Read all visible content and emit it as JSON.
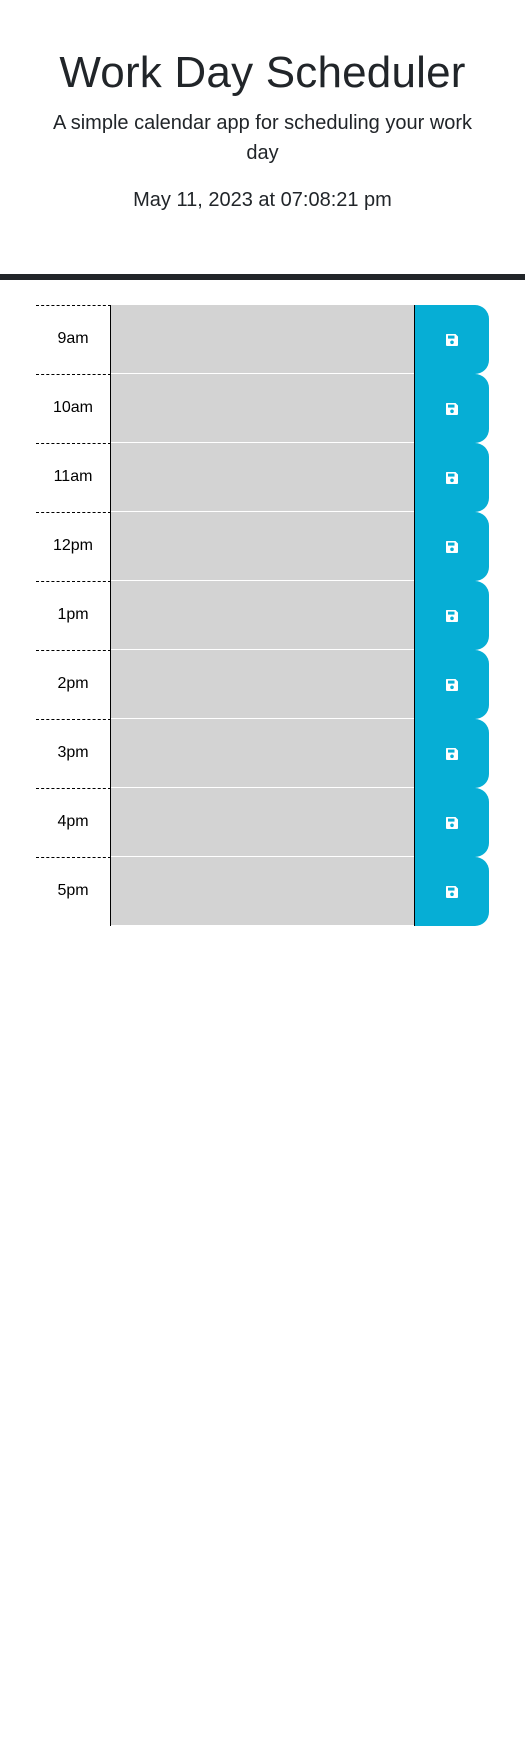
{
  "header": {
    "title": "Work Day Scheduler",
    "lead": "A simple calendar app for scheduling your work day",
    "current_day": "May 11, 2023 at 07:08:21 pm"
  },
  "schedule": {
    "blocks": [
      {
        "hour": "9am",
        "text": ""
      },
      {
        "hour": "10am",
        "text": ""
      },
      {
        "hour": "11am",
        "text": ""
      },
      {
        "hour": "12pm",
        "text": ""
      },
      {
        "hour": "1pm",
        "text": ""
      },
      {
        "hour": "2pm",
        "text": ""
      },
      {
        "hour": "3pm",
        "text": ""
      },
      {
        "hour": "4pm",
        "text": ""
      },
      {
        "hour": "5pm",
        "text": ""
      }
    ],
    "save_icon": "floppy-disk-icon"
  },
  "colors": {
    "past_block": "#d3d3d3",
    "save_button": "#06aed5",
    "header_rule": "#212529"
  }
}
